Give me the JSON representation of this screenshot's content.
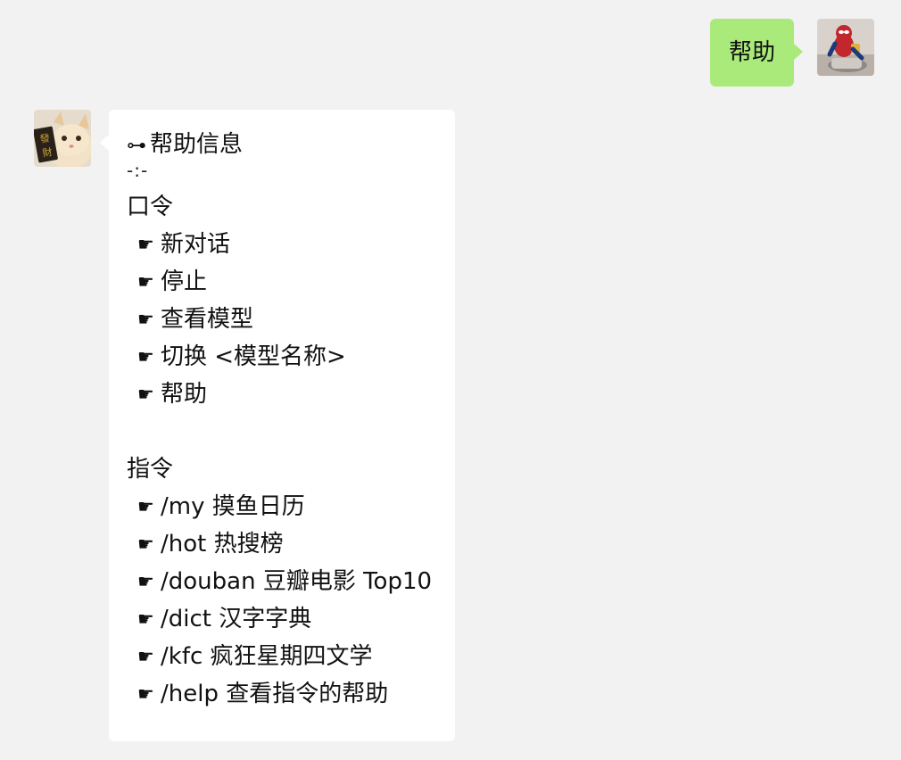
{
  "outgoing_message": {
    "text": "帮助"
  },
  "incoming_message": {
    "title_icon": "⊶",
    "title": "帮助信息",
    "separator": "-:-",
    "password_section": {
      "heading": "口令",
      "bullet": "☛",
      "items": [
        "新对话",
        "停止",
        "查看模型",
        "切换 <模型名称>",
        "帮助"
      ]
    },
    "command_section": {
      "heading": "指令",
      "bullet": "☛",
      "items": [
        "/my 摸鱼日历",
        "/hot 热搜榜",
        "/douban 豆瓣电影 Top10",
        "/dict 汉字字典",
        "/kfc 疯狂星期四文学",
        "/help 查看指令的帮助"
      ]
    }
  },
  "avatars": {
    "me": "spiderman-figure-avatar",
    "bot": "cat-with-fortune-banner-avatar"
  },
  "colors": {
    "background": "#f2f2f2",
    "outgoing_bubble": "#a9ea7a",
    "incoming_bubble": "#ffffff"
  }
}
